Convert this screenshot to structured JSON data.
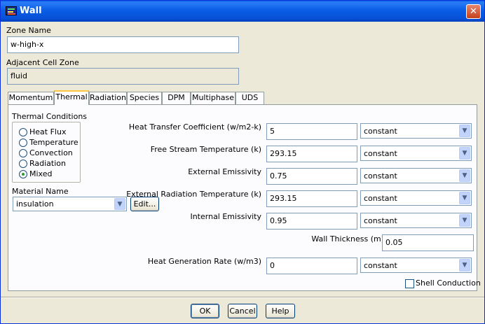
{
  "window": {
    "title": "Wall"
  },
  "zone": {
    "zone_name_label": "Zone Name",
    "zone_name_value": "w-high-x",
    "adjacent_label": "Adjacent Cell Zone",
    "adjacent_value": "fluid"
  },
  "tabs": [
    "Momentum",
    "Thermal",
    "Radiation",
    "Species",
    "DPM",
    "Multiphase",
    "UDS"
  ],
  "active_tab": "Thermal",
  "thermal": {
    "conditions_label": "Thermal Conditions",
    "conditions": [
      {
        "label": "Heat Flux",
        "checked": false
      },
      {
        "label": "Temperature",
        "checked": false
      },
      {
        "label": "Convection",
        "checked": false
      },
      {
        "label": "Radiation",
        "checked": false
      },
      {
        "label": "Mixed",
        "checked": true
      }
    ],
    "material_label": "Material Name",
    "material_value": "insulation",
    "edit_label": "Edit...",
    "fields": {
      "htc": {
        "label": "Heat Transfer Coefficient (w/m2-k)",
        "value": "5",
        "method": "constant"
      },
      "fst": {
        "label": "Free Stream Temperature (k)",
        "value": "293.15",
        "method": "constant"
      },
      "ee": {
        "label": "External Emissivity",
        "value": "0.75",
        "method": "constant"
      },
      "ert": {
        "label": "External Radiation Temperature (k)",
        "value": "293.15",
        "method": "constant"
      },
      "ie": {
        "label": "Internal Emissivity",
        "value": "0.95",
        "method": "constant"
      },
      "wt": {
        "label": "Wall Thickness (m)",
        "value": "0.05"
      },
      "hgr": {
        "label": "Heat Generation Rate (w/m3)",
        "value": "0",
        "method": "constant"
      }
    },
    "shell_label": "Shell Conduction",
    "shell_checked": false
  },
  "buttons": {
    "ok": "OK",
    "cancel": "Cancel",
    "help": "Help"
  },
  "colors": {
    "title_bar": "#0a5ee6",
    "accent": "#ffc83c",
    "close": "#c4411b"
  }
}
